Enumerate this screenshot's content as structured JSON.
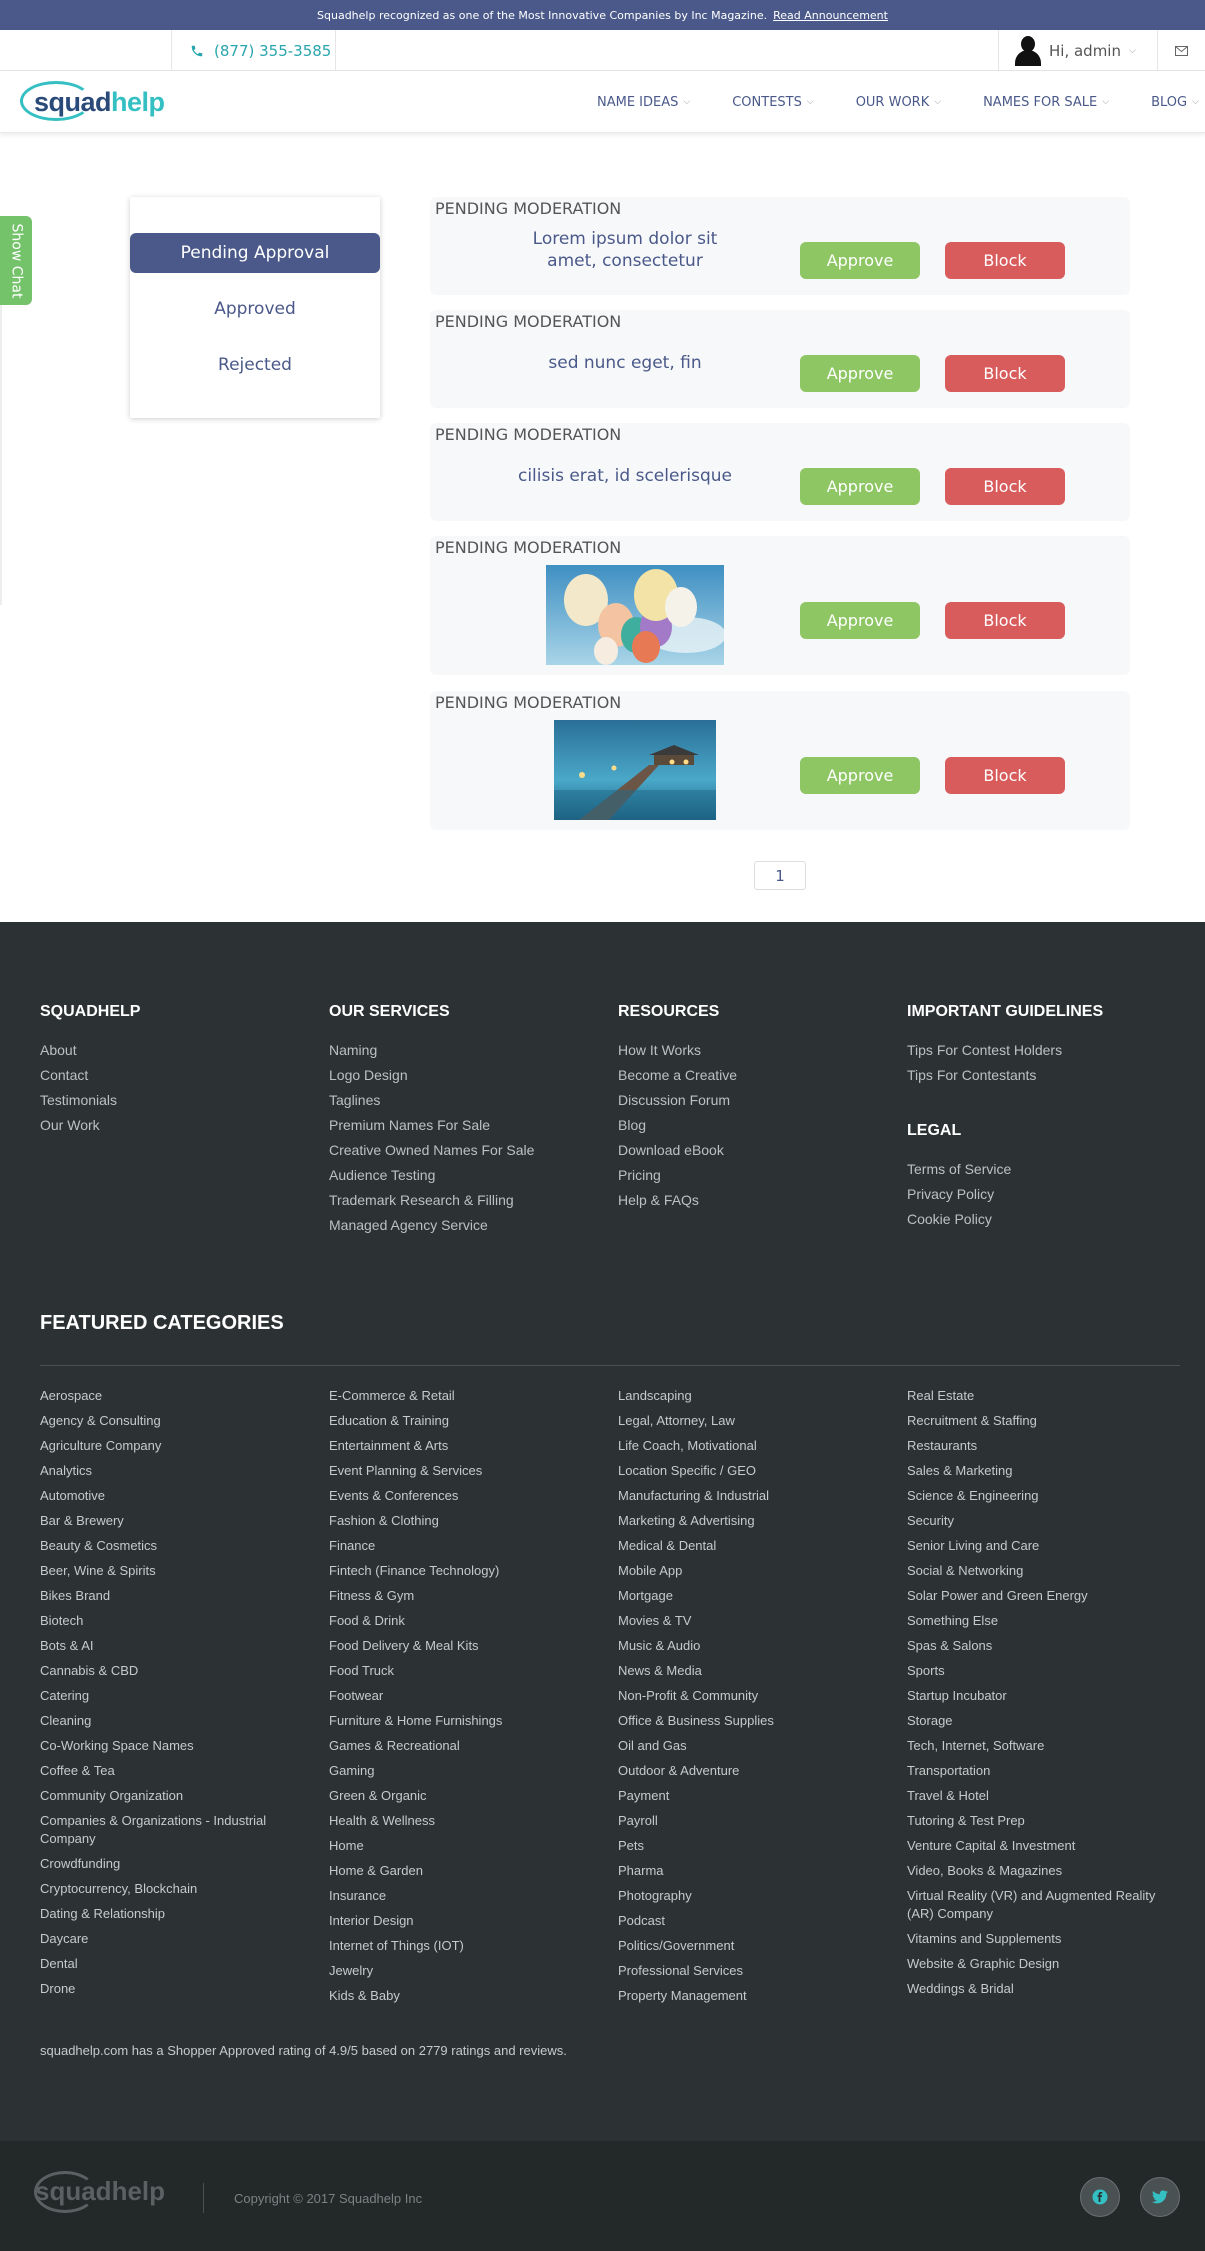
{
  "announcement": {
    "text": "Squadhelp recognized as one of the Most Innovative Companies by Inc Magazine.",
    "link": "Read Announcement"
  },
  "topbar": {
    "phone": "(877) 355-3585",
    "greeting": "Hi, admin"
  },
  "logo": {
    "part1": "squad",
    "part2": "help"
  },
  "nav": [
    "NAME IDEAS",
    "CONTESTS",
    "OUR WORK",
    "NAMES FOR SALE",
    "BLOG"
  ],
  "show_chat": "Show Chat",
  "side_menu": [
    "Pending Approval",
    "Approved",
    "Rejected"
  ],
  "moderation": {
    "label": "PENDING MODERATION",
    "approve": "Approve",
    "block": "Block",
    "items": [
      {
        "text": "Lorem ipsum dolor sit amet, consectetur"
      },
      {
        "text": "sed nunc eget, fin"
      },
      {
        "text": "cilisis erat, id scelerisque"
      },
      {
        "image": "balloons-photo"
      },
      {
        "image": "pier-sunset-photo"
      }
    ]
  },
  "pager": "1",
  "footer": {
    "columns": [
      {
        "title": "SQUADHELP",
        "links": [
          "About",
          "Contact",
          "Testimonials",
          "Our Work"
        ]
      },
      {
        "title": "OUR SERVICES",
        "links": [
          "Naming",
          "Logo Design",
          "Taglines",
          "Premium Names For Sale",
          "Creative Owned Names For Sale",
          "Audience Testing",
          "Trademark Research & Filling",
          "Managed Agency Service"
        ]
      },
      {
        "title": "RESOURCES",
        "links": [
          "How It Works",
          "Become a Creative",
          "Discussion Forum",
          "Blog",
          "Download eBook",
          "Pricing",
          "Help & FAQs"
        ]
      },
      {
        "title": "IMPORTANT GUIDELINES",
        "links": [
          "Tips For Contest Holders",
          "Tips For Contestants"
        ]
      },
      {
        "title": "LEGAL",
        "links": [
          "Terms of Service",
          "Privacy Policy",
          "Cookie Policy"
        ]
      }
    ],
    "featured_title": "FEATURED CATEGORIES",
    "categories": [
      [
        "Aerospace",
        "Agency & Consulting",
        "Agriculture Company",
        "Analytics",
        "Automotive",
        "Bar & Brewery",
        "Beauty & Cosmetics",
        "Beer, Wine & Spirits",
        "Bikes Brand",
        "Biotech",
        "Bots & AI",
        "Cannabis & CBD",
        "Catering",
        "Cleaning",
        "Co-Working Space Names",
        "Coffee & Tea",
        "Community Organization",
        "Companies & Organizations - Industrial Company",
        "Crowdfunding",
        "Cryptocurrency, Blockchain",
        "Dating & Relationship",
        "Daycare",
        "Dental",
        "Drone"
      ],
      [
        "E-Commerce & Retail",
        "Education & Training",
        "Entertainment & Arts",
        "Event Planning & Services",
        "Events & Conferences",
        "Fashion & Clothing",
        "Finance",
        "Fintech (Finance Technology)",
        "Fitness & Gym",
        "Food & Drink",
        "Food Delivery & Meal Kits",
        "Food Truck",
        "Footwear",
        "Furniture & Home Furnishings",
        "Games & Recreational",
        "Gaming",
        "Green & Organic",
        "Health & Wellness",
        "Home",
        "Home & Garden",
        "Insurance",
        "Interior Design",
        "Internet of Things (IOT)",
        "Jewelry",
        "Kids & Baby"
      ],
      [
        "Landscaping",
        "Legal, Attorney, Law",
        "Life Coach, Motivational",
        "Location Specific / GEO",
        "Manufacturing & Industrial",
        "Marketing & Advertising",
        "Medical & Dental",
        "Mobile App",
        "Mortgage",
        "Movies & TV",
        "Music & Audio",
        "News & Media",
        "Non-Profit & Community",
        "Office & Business Supplies",
        "Oil and Gas",
        "Outdoor & Adventure",
        "Payment",
        "Payroll",
        "Pets",
        "Pharma",
        "Photography",
        "Podcast",
        "Politics/Government",
        "Professional Services",
        "Property Management"
      ],
      [
        "Real Estate",
        "Recruitment & Staffing",
        "Restaurants",
        "Sales & Marketing",
        "Science & Engineering",
        "Security",
        "Senior Living and Care",
        "Social & Networking",
        "Solar Power and Green Energy",
        "Something Else",
        "Spas & Salons",
        "Sports",
        "Startup Incubator",
        "Storage",
        "Tech, Internet, Software",
        "Transportation",
        "Travel & Hotel",
        "Tutoring & Test Prep",
        "Venture Capital & Investment",
        "Video, Books & Magazines",
        "Virtual Reality (VR) and Augmented Reality (AR) Company",
        "Vitamins and Supplements",
        "Website & Graphic Design",
        "Weddings & Bridal"
      ]
    ],
    "rating_text": "squadhelp.com has a Shopper Approved rating of 4.9/5 based on 2779 ratings and reviews.",
    "copyright": "Copyright © 2017 Squadhelp Inc",
    "bottom_logo": "squadhelp"
  },
  "colors": {
    "brand_dark": "#4a5989",
    "brand_teal": "#34bfc3",
    "approve": "#8dc663",
    "block": "#d95c5c",
    "footer_bg": "#2c3233"
  }
}
